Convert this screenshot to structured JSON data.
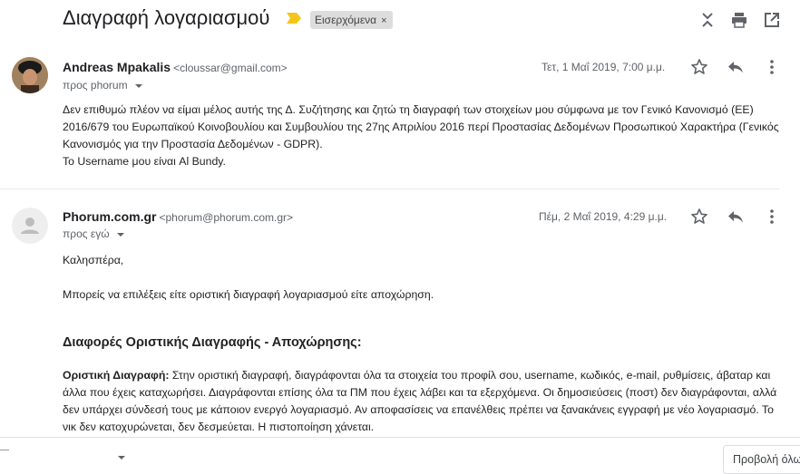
{
  "thread": {
    "subject": "Διαγραφή λογαριασμού",
    "label": "Εισερχόμενα",
    "label_remove": "×",
    "icons": [
      "collapse-icon",
      "print-icon",
      "open-in-new-window-icon"
    ]
  },
  "messages": [
    {
      "sender_name": "Andreas Mpakalis",
      "sender_email": "<cloussar@gmail.com>",
      "recipient": "προς phorum",
      "date": "Τετ, 1 Μαΐ 2019, 7:00 μ.μ.",
      "body": [
        "Δεν επιθυμώ πλέον να είμαι μέλος αυτής της Δ. Συζήτησης και ζητώ τη διαγραφή των στοιχείων μου σύμφωνα με τον Γενικό Κανονισμό (ΕΕ) 2016/679 του Ευρωπαϊκού Κοινοβουλίου και Συμβουλίου της 27ης Απριλίου 2016 περί Προστασίας Δεδομένων Προσωπικού Χαρακτήρα (Γενικός Κανονισμός για την Προστασία Δεδομένων - GDPR).",
        "Το Username μου είναι Al Bundy."
      ]
    },
    {
      "sender_name": "Phorum.com.gr",
      "sender_email": "<phorum@phorum.com.gr>",
      "recipient": "προς εγώ",
      "date": "Πέμ, 2 Μαΐ 2019, 4:29 μ.μ.",
      "greeting": "Καλησπέρα,",
      "intro": "Μπορείς να επιλέξεις είτε οριστική διαγραφή λογαριασμού είτε αποχώρηση.",
      "heading": "Διαφορές Οριστικής Διαγραφής - Αποχώρησης:",
      "definition_term": "Οριστική Διαγραφή:",
      "definition_text": "Στην οριστική διαγραφή, διαγράφονται όλα τα στοιχεία του προφίλ σου, username, κωδικός, e-mail, ρυθμίσεις, άβαταρ και άλλα που έχεις καταχωρήσει. Διαγράφονται επίσης όλα τα ΠΜ που έχεις λάβει και τα εξερχόμενα. Οι δημοσιεύσεις (ποστ) δεν διαγράφονται, αλλά δεν υπάρχει σύνδεσή τους με κάποιον ενεργό λογαριασμό. Αν αποφασίσεις να επανέλθεις πρέπει να ξανακάνεις εγγραφή με νέο λογαριασμό. Το νικ δεν κατοχυρώνεται, δεν δεσμεύεται. Η πιστοποίηση χάνεται."
    }
  ],
  "bottom": {
    "button_label": "Προβολή όλων"
  },
  "colors": {
    "importance_marker": "#f5c518",
    "label_chip": "#dddddd",
    "icon_gray": "#5f6368"
  }
}
